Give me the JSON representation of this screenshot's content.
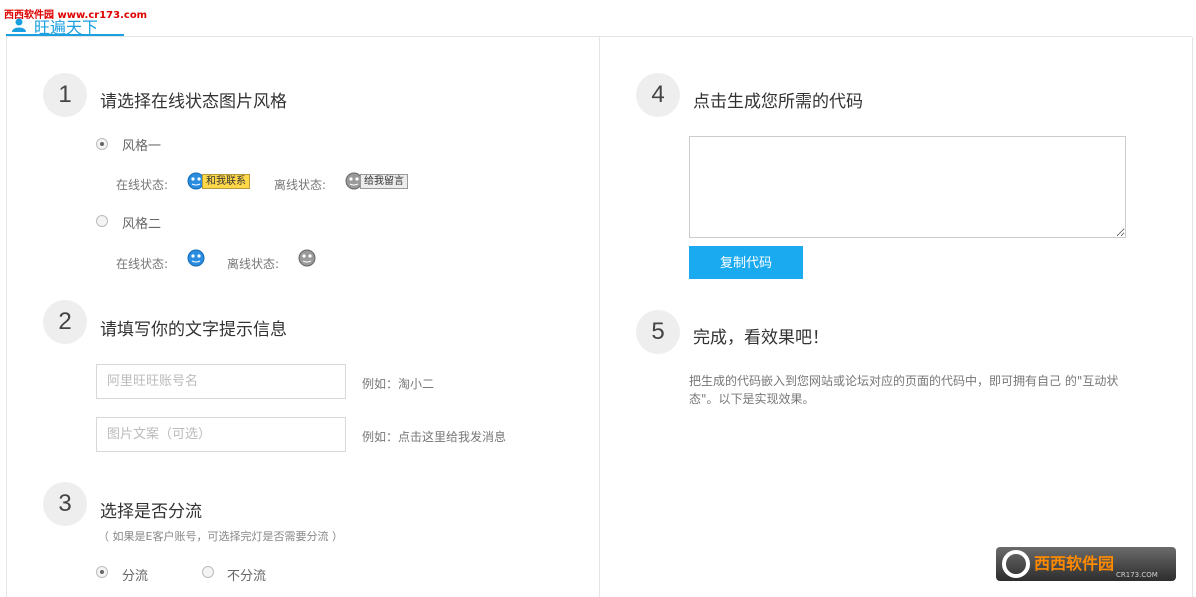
{
  "watermark": {
    "text": "西西软件园 www.cr173.com"
  },
  "header": {
    "title": "旺遍天下"
  },
  "steps": {
    "s1": {
      "num": "1",
      "title": "请选择在线状态图片风格",
      "style1": {
        "label": "风格一",
        "online_label": "在线状态:",
        "online_badge": "和我联系",
        "offline_label": "离线状态:",
        "offline_badge": "给我留言"
      },
      "style2": {
        "label": "风格二",
        "online_label": "在线状态:",
        "offline_label": "离线状态:"
      }
    },
    "s2": {
      "num": "2",
      "title": "请填写你的文字提示信息",
      "account_placeholder": "阿里旺旺账号名",
      "account_hint": "例如：淘小二",
      "text_placeholder": "图片文案（可选）",
      "text_hint": "例如：点击这里给我发消息"
    },
    "s3": {
      "num": "3",
      "title": "选择是否分流",
      "note": "（ 如果是E客户账号，可选择完灯是否需要分流 ）",
      "opt_yes": "分流",
      "opt_no": "不分流"
    },
    "s4": {
      "num": "4",
      "title": "点击生成您所需的代码",
      "code_value": "",
      "copy_label": "复制代码"
    },
    "s5": {
      "num": "5",
      "title": "完成，看效果吧！",
      "desc": "把生成的代码嵌入到您网站或论坛对应的页面的代码中，即可拥有自己 的\"互动状态\"。以下是实现效果。"
    }
  },
  "corner_logo": {
    "main": "西西软件园",
    "sub": "CR173.COM"
  },
  "colors": {
    "accent": "#1aaaf0",
    "step_bg": "#eeeeee"
  }
}
